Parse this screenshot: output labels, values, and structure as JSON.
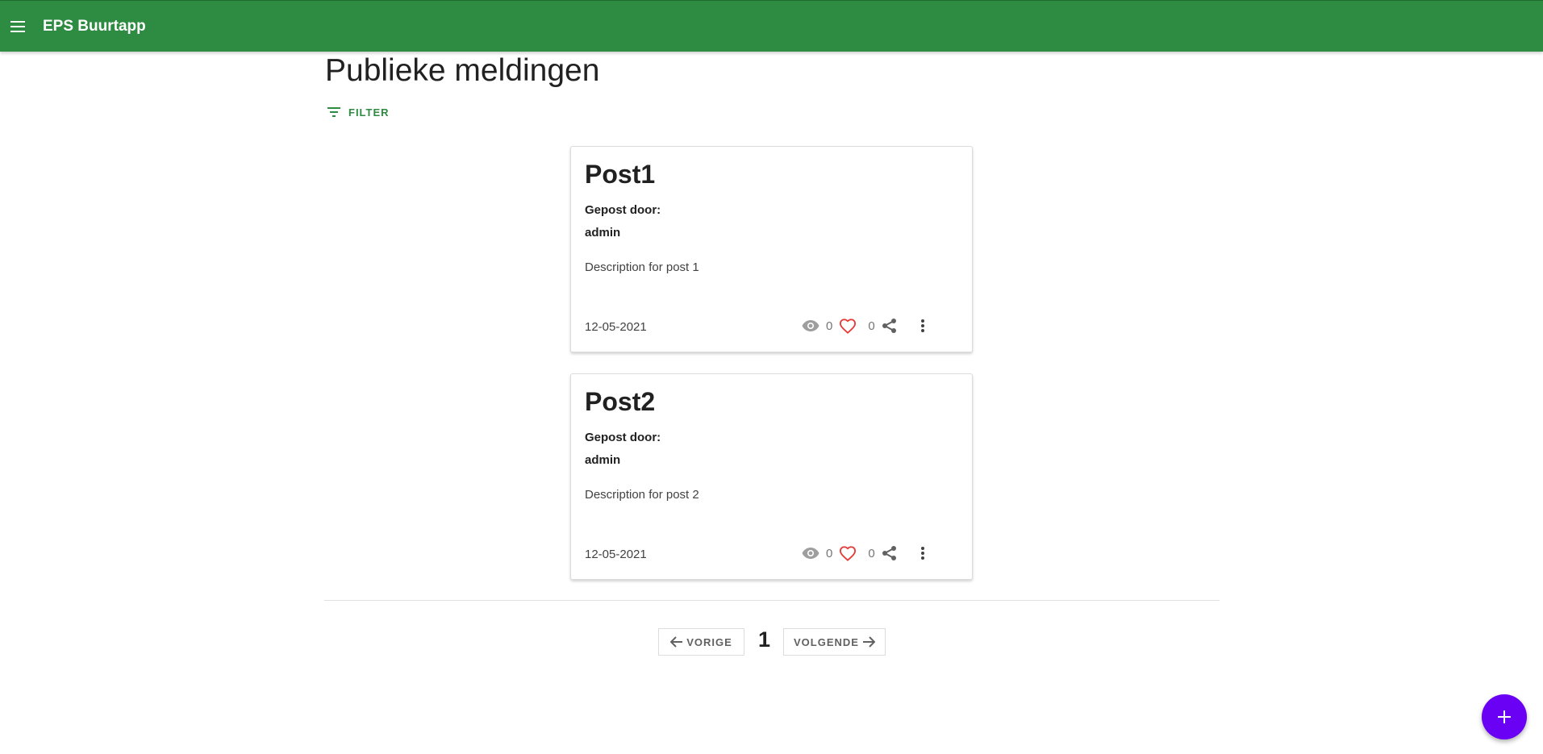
{
  "app": {
    "title": "EPS Buurtapp"
  },
  "page": {
    "title": "Publieke meldingen",
    "filter_label": "FILTER"
  },
  "posts": [
    {
      "title": "Post1",
      "posted_by_label": "Gepost door:",
      "author": "admin",
      "description": "Description for post 1",
      "date": "12-05-2021",
      "views": "0",
      "likes": "0"
    },
    {
      "title": "Post2",
      "posted_by_label": "Gepost door:",
      "author": "admin",
      "description": "Description for post 2",
      "date": "12-05-2021",
      "views": "0",
      "likes": "0"
    }
  ],
  "pagination": {
    "prev_label": "VORIGE",
    "current_page": "1",
    "next_label": "VOLGENDE"
  },
  "colors": {
    "appbar": "#2e8b42",
    "accent": "#2e8b42",
    "heart": "#e53935",
    "fab": "#6a00f4"
  },
  "icons": {
    "menu": "menu-icon",
    "filter": "filter-icon",
    "view": "eye-icon",
    "like": "heart-icon",
    "share": "share-icon",
    "more": "more-vert-icon",
    "prev": "arrow-left-icon",
    "next": "arrow-right-icon",
    "add": "plus-icon"
  }
}
